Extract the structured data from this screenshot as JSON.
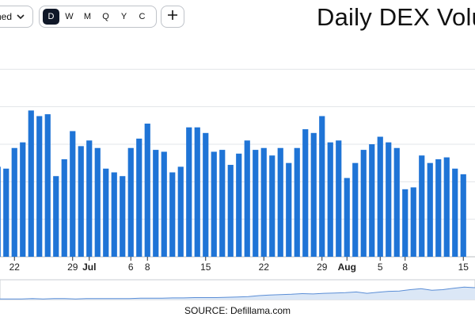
{
  "toolbar": {
    "stack_label": "ned",
    "periods": [
      {
        "label": "D",
        "active": true
      },
      {
        "label": "W",
        "active": false
      },
      {
        "label": "M",
        "active": false
      },
      {
        "label": "Q",
        "active": false
      },
      {
        "label": "Y",
        "active": false
      },
      {
        "label": "C",
        "active": false
      }
    ],
    "add_label": "+"
  },
  "source_text": "SOURCE: Defillama.com",
  "colors": {
    "bar": "#1f74d6",
    "grid": "#e3e5e8",
    "axis": "#b8bcc2",
    "minimap": "#dbe7f6",
    "minimap_line": "#5b8ed6"
  },
  "chart_data": {
    "type": "bar",
    "title": "Daily DEX Volu",
    "x_tick_labels": [
      {
        "label": "22",
        "index": 2
      },
      {
        "label": "29",
        "index": 9
      },
      {
        "label": "Jul",
        "index": 11,
        "bold": true
      },
      {
        "label": "6",
        "index": 16
      },
      {
        "label": "8",
        "index": 18
      },
      {
        "label": "15",
        "index": 25
      },
      {
        "label": "22",
        "index": 32
      },
      {
        "label": "29",
        "index": 39
      },
      {
        "label": "Aug",
        "index": 42,
        "bold": true
      },
      {
        "label": "5",
        "index": 46
      },
      {
        "label": "8",
        "index": 49
      },
      {
        "label": "15",
        "index": 56
      }
    ],
    "values": [
      48,
      47,
      58,
      61,
      78,
      75,
      76,
      43,
      52,
      67,
      59,
      62,
      58,
      47,
      45,
      43,
      58,
      63,
      71,
      57,
      56,
      45,
      48,
      69,
      69,
      66,
      56,
      57,
      49,
      55,
      62,
      57,
      58,
      54,
      58,
      50,
      58,
      68,
      66,
      75,
      61,
      62,
      42,
      50,
      57,
      60,
      64,
      61,
      58,
      36,
      37,
      54,
      50,
      52,
      53,
      47,
      44
    ],
    "ylim": [
      0,
      120
    ],
    "grid": true,
    "minimap": [
      2,
      2,
      2,
      3,
      2,
      3,
      3,
      2,
      3,
      3,
      3,
      3,
      3,
      4,
      4,
      4,
      5,
      5,
      6,
      6,
      6,
      7,
      8,
      9,
      12,
      14,
      15,
      16,
      18,
      17,
      19,
      20,
      21,
      23,
      19,
      22,
      25,
      26,
      30,
      33,
      28,
      30,
      34,
      38,
      36
    ]
  }
}
